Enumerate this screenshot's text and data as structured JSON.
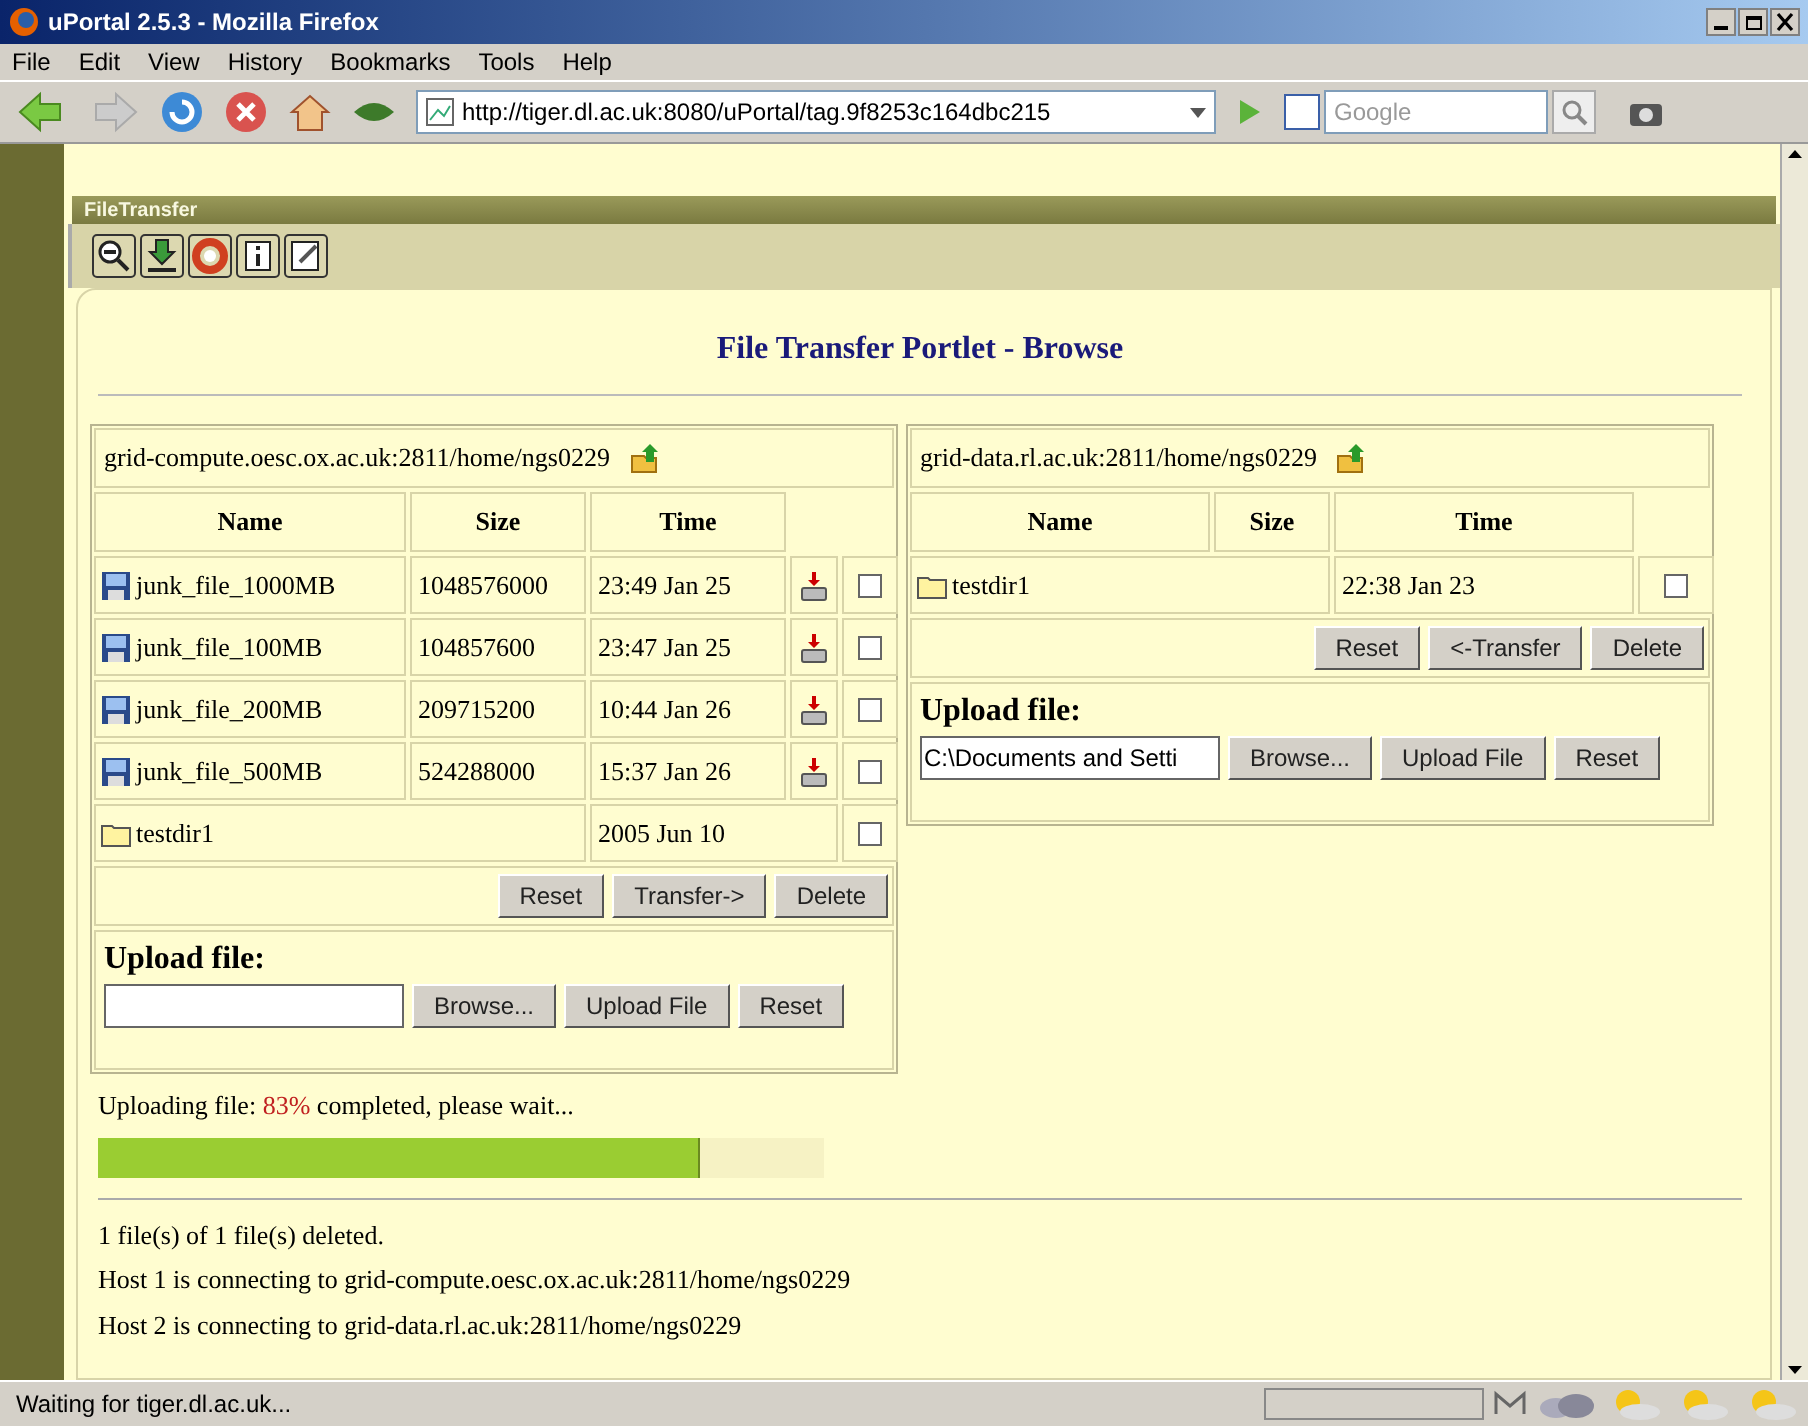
{
  "window": {
    "title": "uPortal 2.5.3 - Mozilla Firefox"
  },
  "menu": [
    "File",
    "Edit",
    "View",
    "History",
    "Bookmarks",
    "Tools",
    "Help"
  ],
  "address_bar": {
    "value": "http://tiger.dl.ac.uk:8080/uPortal/tag.9f8253c164dbc215"
  },
  "search_field": {
    "placeholder": "Google"
  },
  "portlet": {
    "title": "FileTransfer",
    "heading": "File Transfer Portlet - Browse"
  },
  "hosts": [
    {
      "path": "grid-compute.oesc.ox.ac.uk:2811/home/ngs0229",
      "columns": [
        "Name",
        "Size",
        "Time"
      ],
      "rows": [
        {
          "kind": "file",
          "name": "junk_file_1000MB",
          "size": "1048576000",
          "time": "23:49 Jan 25",
          "checked": false
        },
        {
          "kind": "file",
          "name": "junk_file_100MB",
          "size": "104857600",
          "time": "23:47 Jan 25",
          "checked": false
        },
        {
          "kind": "file",
          "name": "junk_file_200MB",
          "size": "209715200",
          "time": "10:44 Jan 26",
          "checked": false
        },
        {
          "kind": "file",
          "name": "junk_file_500MB",
          "size": "524288000",
          "time": "15:37 Jan 26",
          "checked": false
        },
        {
          "kind": "folder",
          "name": "testdir1",
          "time": "2005 Jun 10",
          "checked": false
        }
      ],
      "buttons": [
        "Reset",
        "Transfer->",
        "Delete"
      ],
      "upload": {
        "label": "Upload file:",
        "buttons": [
          "Browse...",
          "Upload File",
          "Reset"
        ]
      }
    },
    {
      "path": "grid-data.rl.ac.uk:2811/home/ngs0229",
      "columns": [
        "Name",
        "Size",
        "Time"
      ],
      "rows": [
        {
          "kind": "folder",
          "name": "testdir1",
          "time": "22:38 Jan 23",
          "checked": false
        }
      ],
      "buttons": [
        "Reset",
        "<-Transfer",
        "Delete"
      ],
      "upload": {
        "label": "Upload file:",
        "value": "C:\\Documents and Setti",
        "buttons": [
          "Browse...",
          "Upload File",
          "Reset"
        ]
      }
    }
  ],
  "upload_status": {
    "prefix": "Uploading file: ",
    "percent": "83%",
    "suffix": " completed, please wait...",
    "level": 0.83
  },
  "messages": [
    "1 file(s) of 1 file(s) deleted.",
    "Host 1 is connecting to grid-compute.oesc.ox.ac.uk:2811/home/ngs0229",
    "Host 2 is connecting to grid-data.rl.ac.uk:2811/home/ngs0229"
  ],
  "status_bar": {
    "text": "Waiting for tiger.dl.ac.uk..."
  }
}
